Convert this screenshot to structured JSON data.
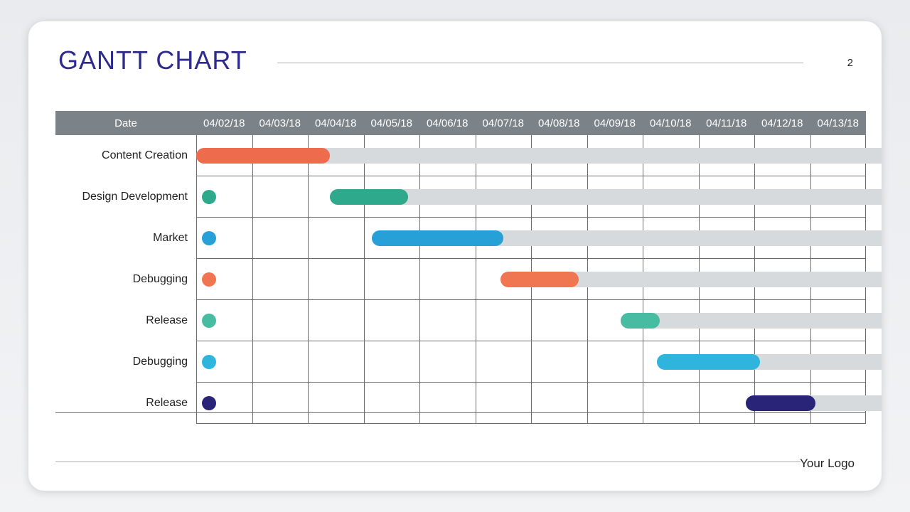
{
  "title": "GANTT CHART",
  "page_number": "2",
  "footer_logo": "Your Logo",
  "header_label": "Date",
  "dates": [
    "04/02/18",
    "04/03/18",
    "04/04/18",
    "04/05/18",
    "04/06/18",
    "04/07/18",
    "04/08/18",
    "04/09/18",
    "04/10/18",
    "04/11/18",
    "04/12/18",
    "04/13/18"
  ],
  "colors": {
    "orange": "#ee6b4d",
    "teal": "#2fa98c",
    "blue": "#27a0d8",
    "orange2": "#ef7650",
    "teal2": "#48bca3",
    "cyan": "#2eb4dd",
    "navy": "#2a2479",
    "track": "#d6dadd"
  },
  "tasks": [
    {
      "name": "Content Creation",
      "color": "orange",
      "dot": false,
      "bar_start": 0.0,
      "bar_span": 2.4,
      "track_start": 0.0,
      "track_span": 12.6
    },
    {
      "name": "Design Development",
      "color": "teal",
      "dot": true,
      "bar_start": 2.4,
      "bar_span": 1.4,
      "track_start": 2.4,
      "track_span": 10.2
    },
    {
      "name": "Market",
      "color": "blue",
      "dot": true,
      "bar_start": 3.15,
      "bar_span": 2.35,
      "track_start": 3.15,
      "track_span": 9.45
    },
    {
      "name": "Debugging",
      "color": "orange2",
      "dot": true,
      "bar_start": 5.45,
      "bar_span": 1.4,
      "track_start": 5.45,
      "track_span": 7.15
    },
    {
      "name": "Release",
      "color": "teal2",
      "dot": true,
      "bar_start": 7.6,
      "bar_span": 0.7,
      "track_start": 7.6,
      "track_span": 5.0
    },
    {
      "name": "Debugging",
      "color": "cyan",
      "dot": true,
      "bar_start": 8.25,
      "bar_span": 1.85,
      "track_start": 8.25,
      "track_span": 4.35
    },
    {
      "name": "Release",
      "color": "navy",
      "dot": true,
      "bar_start": 9.85,
      "bar_span": 1.25,
      "track_start": 9.85,
      "track_span": 2.75
    }
  ],
  "chart_data": {
    "type": "bar",
    "title": "GANTT CHART",
    "xlabel": "Date",
    "ylabel": "",
    "dates": [
      "04/02/18",
      "04/03/18",
      "04/04/18",
      "04/05/18",
      "04/06/18",
      "04/07/18",
      "04/08/18",
      "04/09/18",
      "04/10/18",
      "04/11/18",
      "04/12/18",
      "04/13/18"
    ],
    "tasks": [
      {
        "name": "Content Creation",
        "start": "04/02/18",
        "end": "04/04/18",
        "color": "#ee6b4d"
      },
      {
        "name": "Design Development",
        "start": "04/04/18",
        "end": "04/05/18",
        "color": "#2fa98c"
      },
      {
        "name": "Market",
        "start": "04/05/18",
        "end": "04/07/18",
        "color": "#27a0d8"
      },
      {
        "name": "Debugging",
        "start": "04/07/18",
        "end": "04/08/18",
        "color": "#ef7650"
      },
      {
        "name": "Release",
        "start": "04/09/18",
        "end": "04/10/18",
        "color": "#48bca3"
      },
      {
        "name": "Debugging",
        "start": "04/10/18",
        "end": "04/12/18",
        "color": "#2eb4dd"
      },
      {
        "name": "Release",
        "start": "04/11/18",
        "end": "04/13/18",
        "color": "#2a2479"
      }
    ]
  }
}
